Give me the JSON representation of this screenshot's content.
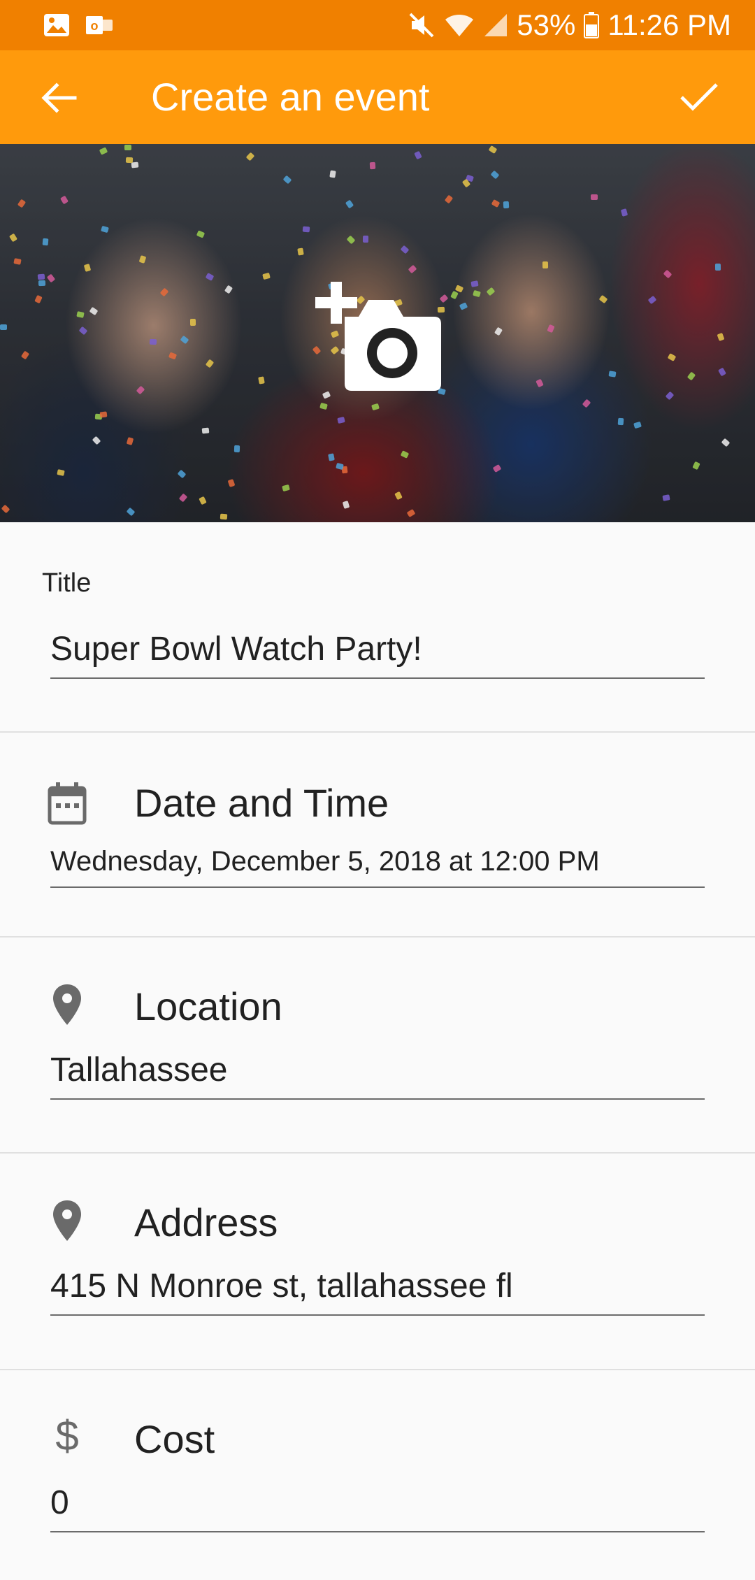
{
  "status_bar": {
    "battery": "53%",
    "time": "11:26 PM",
    "icons": [
      "gallery-icon",
      "outlook-icon",
      "mute-icon",
      "wifi-icon",
      "signal-icon",
      "battery-icon"
    ]
  },
  "app_bar": {
    "title": "Create an event",
    "back_icon": "arrow-back-icon",
    "confirm_icon": "check-icon",
    "background": "#ff9a0c",
    "status_background": "#f08000"
  },
  "hero": {
    "add_photo_icon": "add-photo-camera-icon"
  },
  "form": {
    "title": {
      "label": "Title",
      "value": "Super Bowl Watch Party!"
    },
    "date_time": {
      "label": "Date and Time",
      "value": "Wednesday, December 5, 2018 at 12:00 PM",
      "icon": "calendar-icon"
    },
    "location": {
      "label": "Location",
      "value": "Tallahassee",
      "icon": "location-pin-icon"
    },
    "address": {
      "label": "Address",
      "value": "415 N Monroe st, tallahassee fl",
      "icon": "location-pin-icon"
    },
    "cost": {
      "label": "Cost",
      "value": "0",
      "icon": "dollar-icon"
    }
  }
}
